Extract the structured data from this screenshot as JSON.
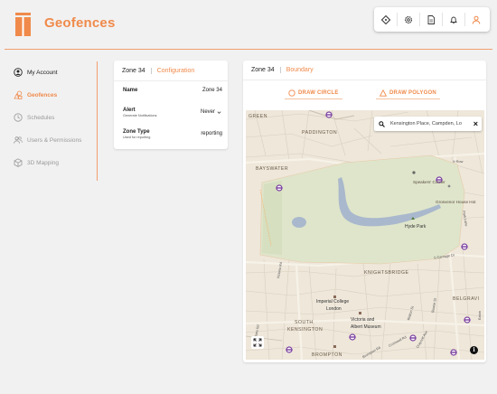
{
  "app": {
    "title": "Geofences"
  },
  "toolbar": {
    "items": [
      "location-diamond-icon",
      "settings-icon",
      "document-icon",
      "bell-icon",
      "user-icon"
    ]
  },
  "sidebar": {
    "items": [
      {
        "label": "My Account",
        "icon": "account-circle-icon"
      },
      {
        "label": "Geofences",
        "icon": "geofence-shapes-icon"
      },
      {
        "label": "Schedules",
        "icon": "clock-icon"
      },
      {
        "label": "Users & Permissions",
        "icon": "users-icon"
      },
      {
        "label": "3D Mapping",
        "icon": "cube-icon"
      }
    ]
  },
  "config_card": {
    "zone": "Zone 34",
    "tab": "Configuration",
    "rows": [
      {
        "label": "Name",
        "sublabel": "",
        "value": "Zone 34"
      },
      {
        "label": "Alert",
        "sublabel": "Generate Notifications",
        "value": "Never"
      },
      {
        "label": "Zone Type",
        "sublabel": "Used for reporting",
        "value": "reporting"
      }
    ]
  },
  "map_card": {
    "zone": "Zone 34",
    "tab": "Boundary",
    "draw_circle": "DRAW CIRCLE",
    "draw_polygon": "DRAW POLYGON",
    "search_value": "Kensington Place, Campden, Lo",
    "labels": {
      "green": "GREEN",
      "paddington": "PADDINGTON",
      "bayswater": "BAYSWATER",
      "speakers_corner": "Speakers' Corner",
      "grosvenor": "Grosvenor House Hot",
      "hyde_park": "Hyde Park",
      "knightsbridge": "KNIGHTSBRIDGE",
      "imperial_1": "Imperial College",
      "imperial_2": "London",
      "va_1": "Victoria and",
      "va_2": "Albert Museum",
      "south": "SOUTH",
      "kensington": "KENSINGTON",
      "belgravi": "BELGRAVI",
      "brompton": "BROMPTON",
      "park_lane": "Park Lane",
      "carriage_dr": "S Carriage Dr",
      "n_row": "N Row",
      "victoria_rd": "Victoria Rd",
      "marloes_rd": "Marloes Rd",
      "cromwell_rd": "Cromwell Rd",
      "gloucester_rd": "Gloucester Rd",
      "sloane_st": "Sloane St",
      "brompton_rd": "Brompton Rd",
      "walton_st": "Walton St",
      "draycott": "Draycott Ave",
      "eaton": "Eaton"
    }
  },
  "colors": {
    "accent": "#f08a4b",
    "park": "#dfe5cb",
    "water": "#a9b8cc",
    "map_bg": "#eee7da"
  }
}
